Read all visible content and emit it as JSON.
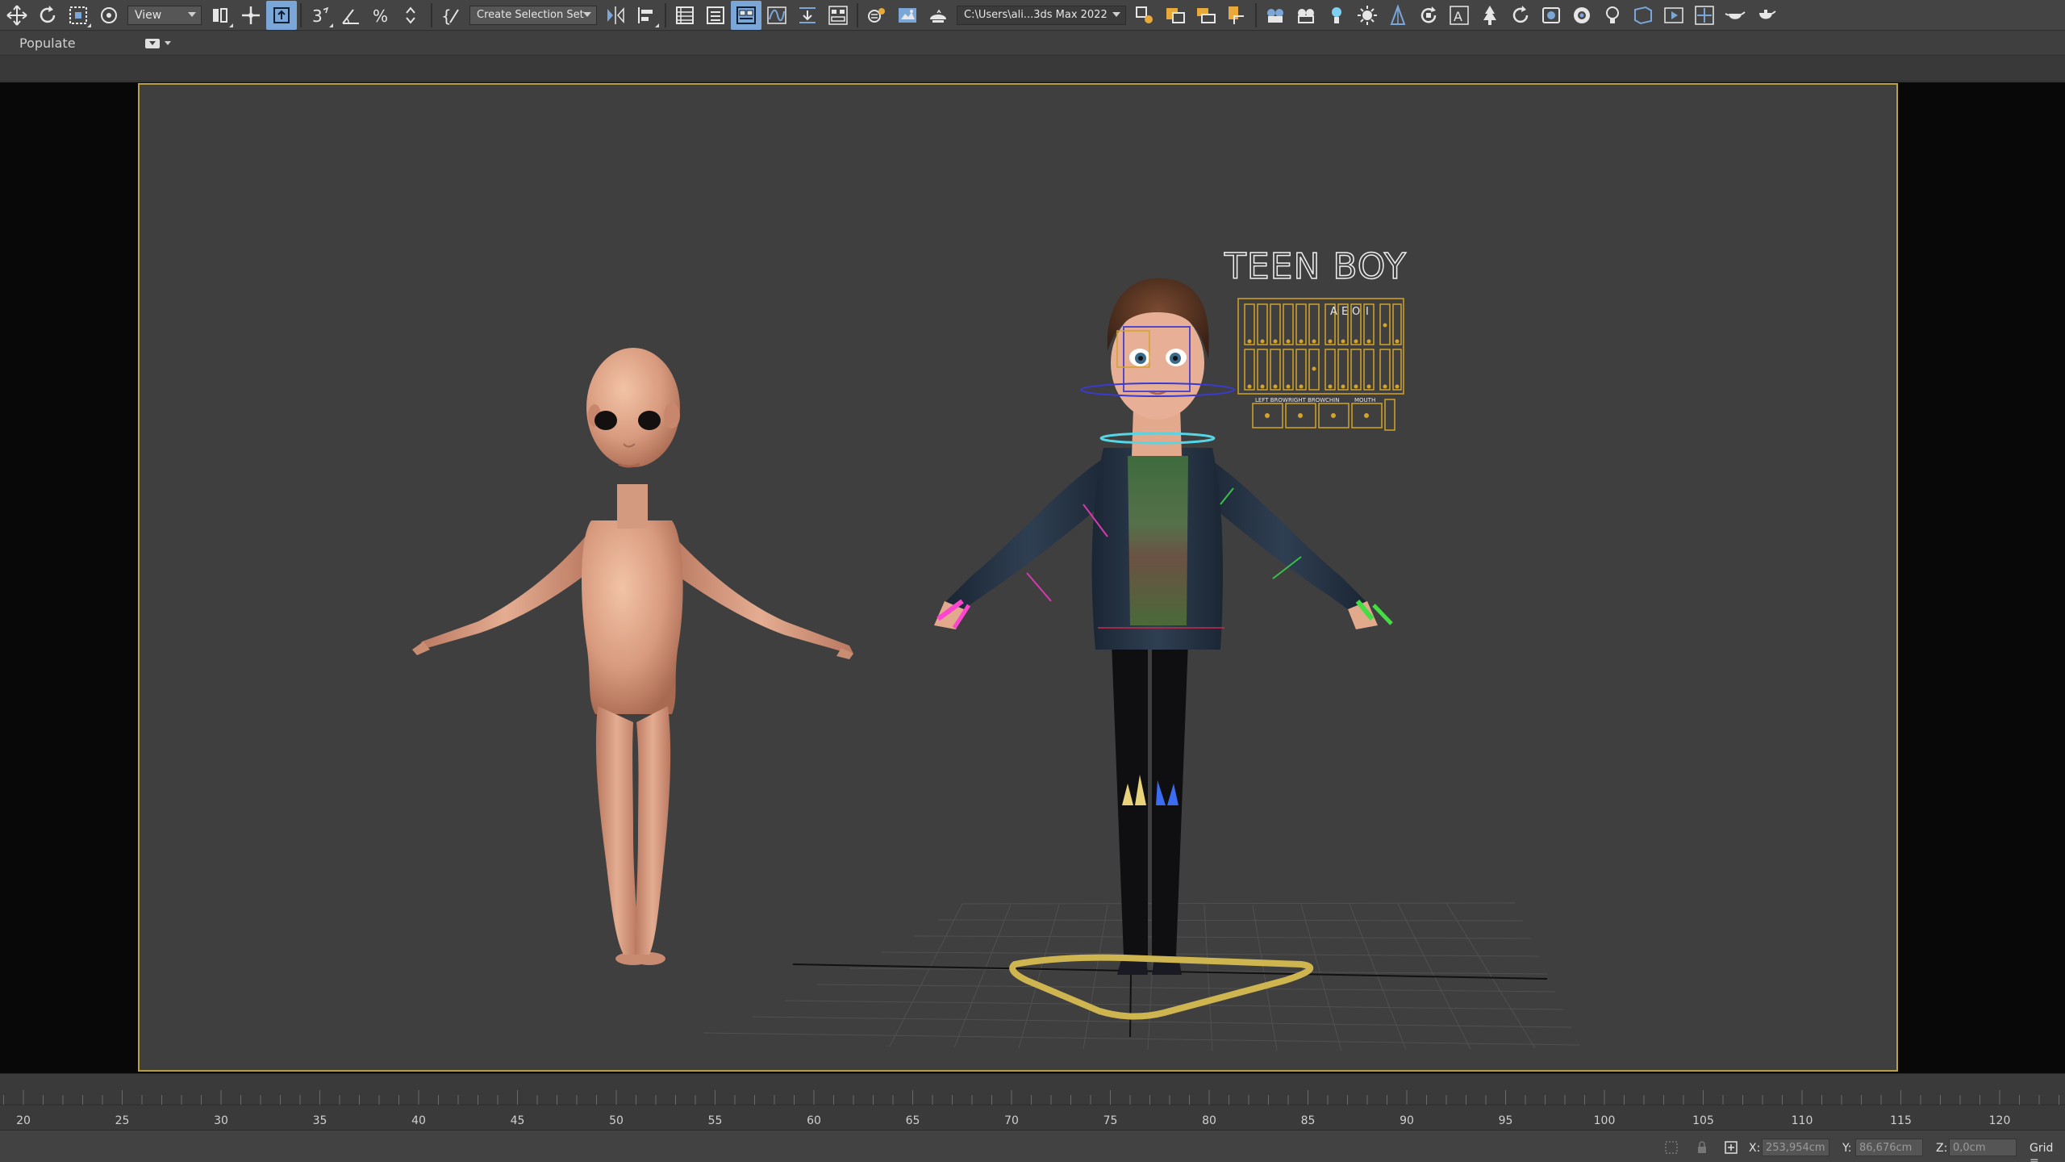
{
  "toolbar": {
    "view_dropdown": "View",
    "selection_set_dropdown": "Create Selection Set",
    "project_path": "C:\\Users\\ali...3ds Max 2022",
    "icons_left": [
      "select-move-icon",
      "rotate-icon",
      "scale-region-icon",
      "select-object-icon"
    ],
    "icons_mid": [
      "select-and-link-icon",
      "move-gizmo-icon",
      "select-and-manipulate-icon",
      "snap-3d-icon",
      "angle-snap-icon",
      "percent-snap-icon",
      "spinner-snap-icon",
      "edit-named-selection-icon"
    ],
    "icons_right": [
      "mirror-icon",
      "align-icon",
      "scene-explorer-icon",
      "layer-explorer-icon",
      "ribbon-toggle-icon",
      "curve-editor-icon",
      "dope-sheet-icon",
      "schematic-view-icon",
      "material-editor-icon",
      "render-setup-icon",
      "render-frame-icon"
    ],
    "icons_far_right": [
      "create-light-icon",
      "create-camera-icon",
      "create-helper-icon",
      "create-geometry-icon",
      "create-spacewarp-icon",
      "create-system-icon",
      "create-shape-icon",
      "create-tree-icon",
      "modify-icon",
      "text-icon",
      "foliage-icon",
      "rotate-view-icon",
      "render-icon",
      "snapshot-icon",
      "bulb-icon",
      "viewport-icon",
      "play-icon",
      "maximize-icon",
      "teapot-render-icon",
      "teapot-icon",
      "grid-icon"
    ]
  },
  "ribbon": {
    "tab_populate": "Populate"
  },
  "viewport": {
    "rig_title": "TEEN BOY",
    "rig_panel_labels": [
      "A",
      "E",
      "O",
      "I"
    ],
    "rig_panel_bottom_labels": [
      "LEFT BROW",
      "RIGHT BROW",
      "CHIN",
      "MOUTH"
    ]
  },
  "timeline": {
    "ticks": [
      "20",
      "25",
      "30",
      "35",
      "40",
      "45",
      "50",
      "55",
      "60",
      "65",
      "70",
      "75",
      "80",
      "85",
      "90",
      "95",
      "100",
      "105",
      "110",
      "115",
      "120"
    ]
  },
  "statusbar": {
    "x_label": "X:",
    "x_value": "253,954cm",
    "y_label": "Y:",
    "y_value": "86,676cm",
    "z_label": "Z:",
    "z_value": "0,0cm",
    "grid_label": "Grid ="
  },
  "colors": {
    "viewport_bg": "#3f3f3f",
    "viewport_border": "#b9a046",
    "active_tool": "#7aa6d8",
    "rig_gold": "#d4a32a"
  }
}
